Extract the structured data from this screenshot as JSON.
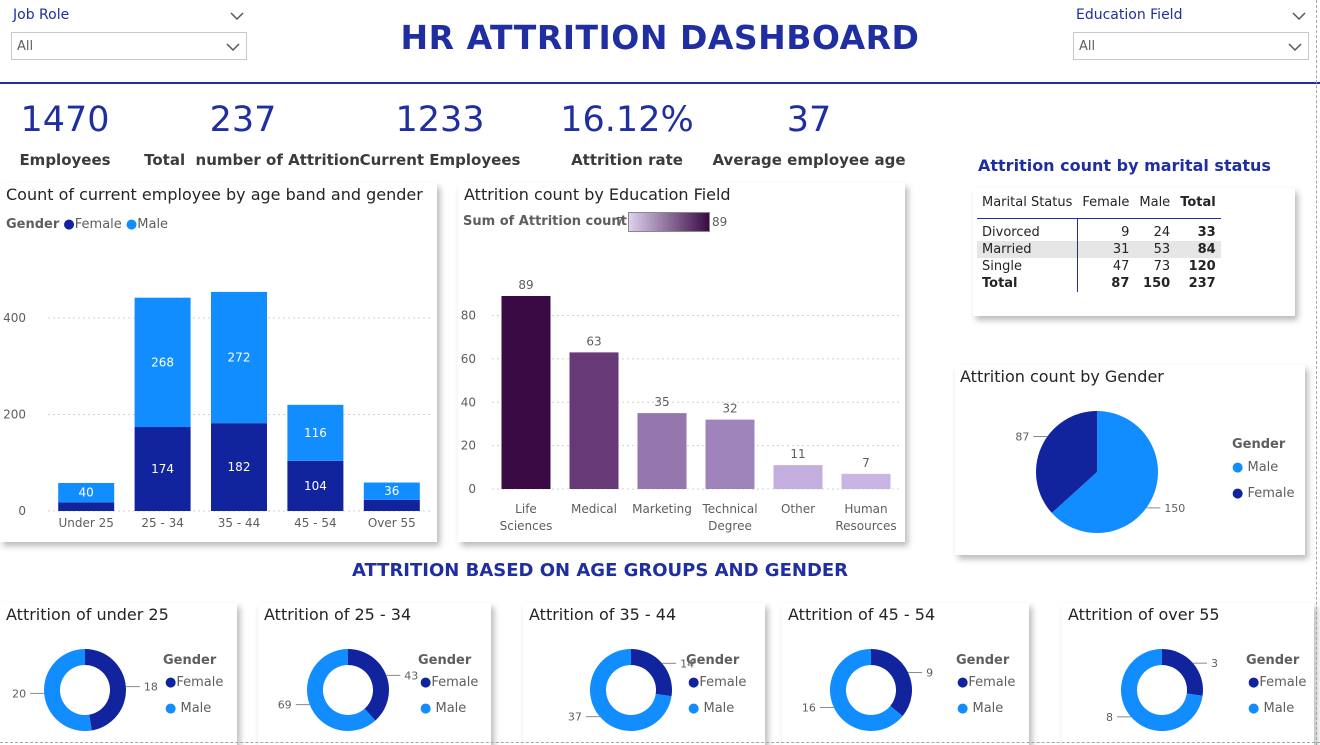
{
  "title": "HR ATTRITION DASHBOARD",
  "slicers": {
    "job_role": {
      "label": "Job Role",
      "value": "All"
    },
    "education_field": {
      "label": "Education Field",
      "value": "All"
    }
  },
  "kpis": [
    {
      "value": "1470",
      "label": "Employees"
    },
    {
      "value": "237",
      "label": "Total  number of Attrition"
    },
    {
      "value": "1233",
      "label": "Current Employees"
    },
    {
      "value": "16.12%",
      "label": "Attrition rate"
    },
    {
      "value": "37",
      "label": "Average employee age"
    }
  ],
  "colors": {
    "female": "#12239e",
    "male": "#118dff",
    "accent": "#1f2ea0"
  },
  "marital": {
    "title": "Attrition count by marital status",
    "headers": [
      "Marital Status",
      "Female",
      "Male",
      "Total"
    ],
    "rows": [
      [
        "Divorced",
        "9",
        "24",
        "33"
      ],
      [
        "Married",
        "31",
        "53",
        "84"
      ],
      [
        "Single",
        "47",
        "73",
        "120"
      ]
    ],
    "total": [
      "Total",
      "87",
      "150",
      "237"
    ]
  },
  "section_title": "ATTRITION BASED ON AGE GROUPS AND GENDER",
  "chart_data": [
    {
      "type": "bar",
      "title": "Count of current employee by age band and gender",
      "legend_title": "Gender",
      "categories": [
        "Under 25",
        "25 - 34",
        "35 - 44",
        "45 - 54",
        "Over 55"
      ],
      "series": [
        {
          "name": "Female",
          "values": [
            18,
            174,
            182,
            104,
            23
          ]
        },
        {
          "name": "Male",
          "values": [
            40,
            268,
            272,
            116,
            36
          ]
        }
      ],
      "stacked": true,
      "yticks": [
        "0",
        "200",
        "400"
      ],
      "ylim": [
        0,
        460
      ]
    },
    {
      "type": "bar",
      "title": "Attrition count by Education Field",
      "legend_title": "Sum of Attrition count",
      "gradient_min": "7",
      "gradient_max": "89",
      "categories": [
        "Life Sciences",
        "Medical",
        "Marketing",
        "Technical Degree",
        "Other",
        "Human Resources"
      ],
      "category_lines": [
        [
          "Life",
          "Sciences"
        ],
        [
          "Medical"
        ],
        [
          "Marketing"
        ],
        [
          "Technical",
          "Degree"
        ],
        [
          "Other"
        ],
        [
          "Human",
          "Resources"
        ]
      ],
      "values": [
        89,
        63,
        35,
        32,
        11,
        7
      ],
      "colors": [
        "#3a0a45",
        "#673a77",
        "#9576ad",
        "#9f84bb",
        "#c4aedd",
        "#c9b5e3"
      ],
      "yticks": [
        "0",
        "20",
        "40",
        "60",
        "80"
      ],
      "ylim": [
        0,
        95
      ]
    },
    {
      "type": "pie",
      "title": "Attrition count by Gender",
      "legend_title": "Gender",
      "legend": [
        "Male",
        "Female"
      ],
      "slices": [
        {
          "name": "Male",
          "value": 150
        },
        {
          "name": "Female",
          "value": 87
        }
      ],
      "labels": [
        "150",
        "87"
      ]
    },
    {
      "type": "pie",
      "donut": true,
      "title": "Attrition of under 25",
      "legend_title": "Gender",
      "legend": [
        "Female",
        "Male"
      ],
      "female": 18,
      "male": 20,
      "labels": [
        "18",
        "20"
      ]
    },
    {
      "type": "pie",
      "donut": true,
      "title": "Attrition of 25 - 34",
      "legend_title": "Gender",
      "legend": [
        "Female",
        "Male"
      ],
      "female": 43,
      "male": 69,
      "labels": [
        "43",
        "69"
      ]
    },
    {
      "type": "pie",
      "donut": true,
      "title": "Attrition of 35 - 44",
      "legend_title": "Gender",
      "legend": [
        "Female",
        "Male"
      ],
      "female": 14,
      "male": 37,
      "labels": [
        "14",
        "37"
      ]
    },
    {
      "type": "pie",
      "donut": true,
      "title": "Attrition of 45 - 54",
      "legend_title": "Gender",
      "legend": [
        "Female",
        "Male"
      ],
      "female": 9,
      "male": 16,
      "labels": [
        "9",
        "16"
      ]
    },
    {
      "type": "pie",
      "donut": true,
      "title": "Attrition of over 55",
      "legend_title": "Gender",
      "legend": [
        "Female",
        "Male"
      ],
      "female": 3,
      "male": 8,
      "labels": [
        "3",
        "8"
      ]
    }
  ]
}
